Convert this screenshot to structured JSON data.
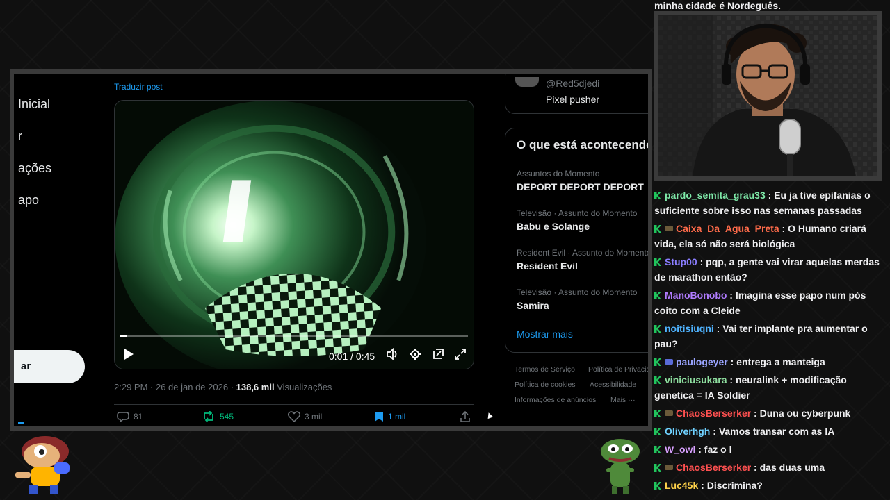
{
  "nav": {
    "items": [
      "Inicial",
      "r",
      "ações",
      "apo"
    ],
    "post_button": "ar"
  },
  "post": {
    "translate": "Traduzir post",
    "video": {
      "time": "0:01 / 0:45",
      "progress": 0.02
    },
    "timestamp": "2:29 PM · 26 de jan de 2026 · ",
    "views_count": "138,6 mil",
    "views_label": " Visualizações",
    "actions": {
      "replies": "81",
      "reposts": "545",
      "likes": "3 mil",
      "bookmarks": "1 mil"
    }
  },
  "sidebar": {
    "who": {
      "handle": "@Red5djedi",
      "bio": "Pixel pusher"
    },
    "trends_title": "O que está acontecendo",
    "trends": [
      {
        "context": "Assuntos do Momento",
        "name": "DEPORT DEPORT DEPORT"
      },
      {
        "context": "Televisão · Assunto do Momento",
        "name": "Babu e Solange"
      },
      {
        "context": "Resident Evil · Assunto do Momento",
        "name": "Resident Evil"
      },
      {
        "context": "Televisão · Assunto do Momento",
        "name": "Samira"
      }
    ],
    "show_more": "Mostrar mais",
    "footer": {
      "terms": "Termos de Serviço",
      "privacy": "Política de Privacidade",
      "cookies": "Política de cookies",
      "accessibility": "Acessibilidade",
      "ads": "Informações de anúncios",
      "more": "Mais ···"
    }
  },
  "chat": {
    "top_partial": "minha cidade é Nordeguês.",
    "hidden_partial": "nós ser ainda mais o faz 100",
    "messages": [
      {
        "user": "pardo_semita_grau33",
        "color": "#7ee8a8",
        "text": "Eu ja tive epifanias o suficiente sobre isso nas semanas passadas"
      },
      {
        "user": "Caixa_Da_Agua_Preta",
        "color": "#ff6b4a",
        "text": "O Humano criará vida, ela só não será biológica"
      },
      {
        "user": "Stup00",
        "color": "#8a7dff",
        "text": "pqp, a gente vai virar aquelas merdas de marathon então?"
      },
      {
        "user": "ManoBonobo",
        "color": "#b07cff",
        "text": "Imagina esse papo num pós coito com a Cleide"
      },
      {
        "user": "noitisiuqni",
        "color": "#4fb3ff",
        "text": "Vai ter implante pra aumentar o pau?"
      },
      {
        "user": "paulogeyer",
        "color": "#9aa4ff",
        "text": "entrega a manteiga"
      },
      {
        "user": "viniciusukara",
        "color": "#8fe0a0",
        "text": "neuralink + modificação genetica = IA Soldier"
      },
      {
        "user": "ChaosBerserker",
        "color": "#ff5050",
        "text": "Duna ou cyberpunk"
      },
      {
        "user": "Oliverhgh",
        "color": "#6fd1ff",
        "text": "Vamos transar com as IA"
      },
      {
        "user": "W_owl",
        "color": "#d8a0ff",
        "text": "faz o l"
      },
      {
        "user": "ChaosBerserker",
        "color": "#ff5050",
        "text": "das duas uma"
      },
      {
        "user": "Luc45k",
        "color": "#ffd24a",
        "text": "Discrimina?"
      }
    ]
  },
  "colors": {
    "accent": "#1d9bf0",
    "mod_badge": "#21c55d",
    "repost": "#00ba7c"
  }
}
